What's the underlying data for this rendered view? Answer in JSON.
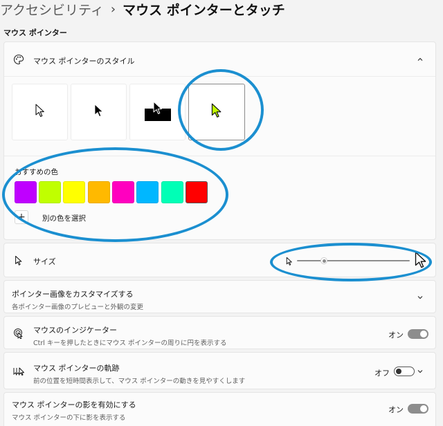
{
  "breadcrumb": {
    "parent": "アクセシビリティ",
    "separator": "›",
    "current": "マウス ポインターとタッチ"
  },
  "section": {
    "title": "マウス ポインター"
  },
  "pointer_style": {
    "title": "マウス ポインターのスタイル",
    "icon": "palette-icon",
    "styles": [
      "white",
      "black",
      "inverted",
      "custom"
    ],
    "selected_style": "custom",
    "selected_color": "#c0ff00"
  },
  "colors": {
    "label": "おすすめの色",
    "swatches": [
      "#bf00ff",
      "#c0ff00",
      "#ffff00",
      "#ffb900",
      "#ff00bf",
      "#00b7ff",
      "#00ffb6",
      "#ff0000"
    ],
    "custom_label": "別の色を選択"
  },
  "size": {
    "label": "サイズ",
    "value_fraction": 0.24
  },
  "customize": {
    "title": "ポインター画像をカスタマイズする",
    "subtitle": "各ポインター画像のプレビューと外観の変更"
  },
  "indicator": {
    "title": "マウスのインジケーター",
    "subtitle": "Ctrl キーを押したときにマウス ポインターの周りに円を表示する",
    "state_label": "オン"
  },
  "trails": {
    "title": "マウス ポインターの軌跡",
    "subtitle": "前の位置を短時間表示して、マウス ポインターの動きを見やすくします",
    "state_label": "オフ"
  },
  "shadow": {
    "title": "マウス ポインターの影を有効にする",
    "subtitle": "マウス ポインターの下に影を表示する",
    "state_label": "オン"
  },
  "annotation_color": "#1b8fd0"
}
